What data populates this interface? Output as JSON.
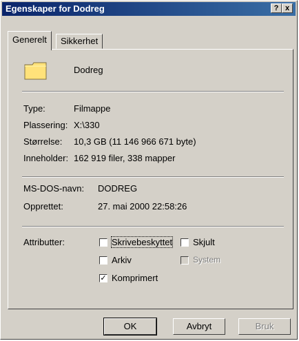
{
  "window": {
    "title": "Egenskaper for Dodreg"
  },
  "titlebar": {
    "help": "?",
    "close": "x"
  },
  "tabs": [
    {
      "label": "Generelt",
      "active": true
    },
    {
      "label": "Sikkerhet",
      "active": false
    }
  ],
  "folder": {
    "name": "Dodreg",
    "icon": "folder-icon",
    "color": "#ffe27a"
  },
  "info": {
    "type_label": "Type:",
    "type_value": "Filmappe",
    "location_label": "Plassering:",
    "location_value": "X:\\330",
    "size_label": "Størrelse:",
    "size_value": "10,3 GB (11 146 966 671 byte)",
    "contains_label": "Inneholder:",
    "contains_value": "162 919 filer, 338 mapper",
    "msdos_label": "MS-DOS-navn:",
    "msdos_value": "DODREG",
    "created_label": "Opprettet:",
    "created_value": "27. mai 2000 22:58:26"
  },
  "attributes": {
    "label": "Attributter:",
    "items": [
      {
        "label": "Skrivebeskyttet",
        "checked": false,
        "enabled": true
      },
      {
        "label": "Skjult",
        "checked": false,
        "enabled": true
      },
      {
        "label": "Arkiv",
        "checked": false,
        "enabled": true
      },
      {
        "label": "System",
        "checked": false,
        "enabled": false
      },
      {
        "label": "Komprimert",
        "checked": true,
        "enabled": true
      }
    ]
  },
  "buttons": {
    "ok": "OK",
    "cancel": "Avbryt",
    "apply": "Bruk"
  }
}
